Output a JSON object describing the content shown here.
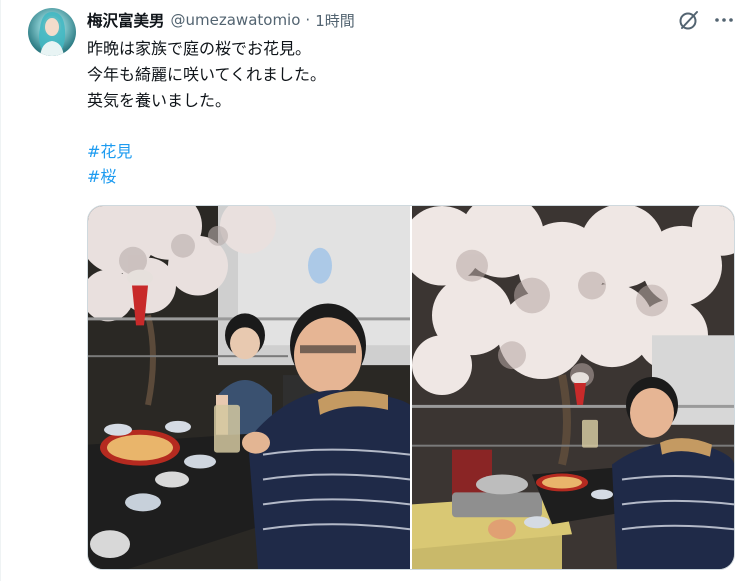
{
  "post": {
    "author_name": "梅沢富美男",
    "author_handle": "@umezawatomio",
    "separator": "·",
    "timestamp": "1時間",
    "text_lines": [
      "昨晩は家族で庭の桜でお花見。",
      "今年も綺麗に咲いてくれました。",
      "英気を養いました。"
    ],
    "hashtags": [
      "#花見",
      "#桜"
    ],
    "media_count": 2
  },
  "icons": {
    "grok": "grok-icon",
    "more": "more-options-icon"
  },
  "colors": {
    "link": "#1d9bf0",
    "secondary_text": "#536471",
    "text": "#0f1419"
  }
}
